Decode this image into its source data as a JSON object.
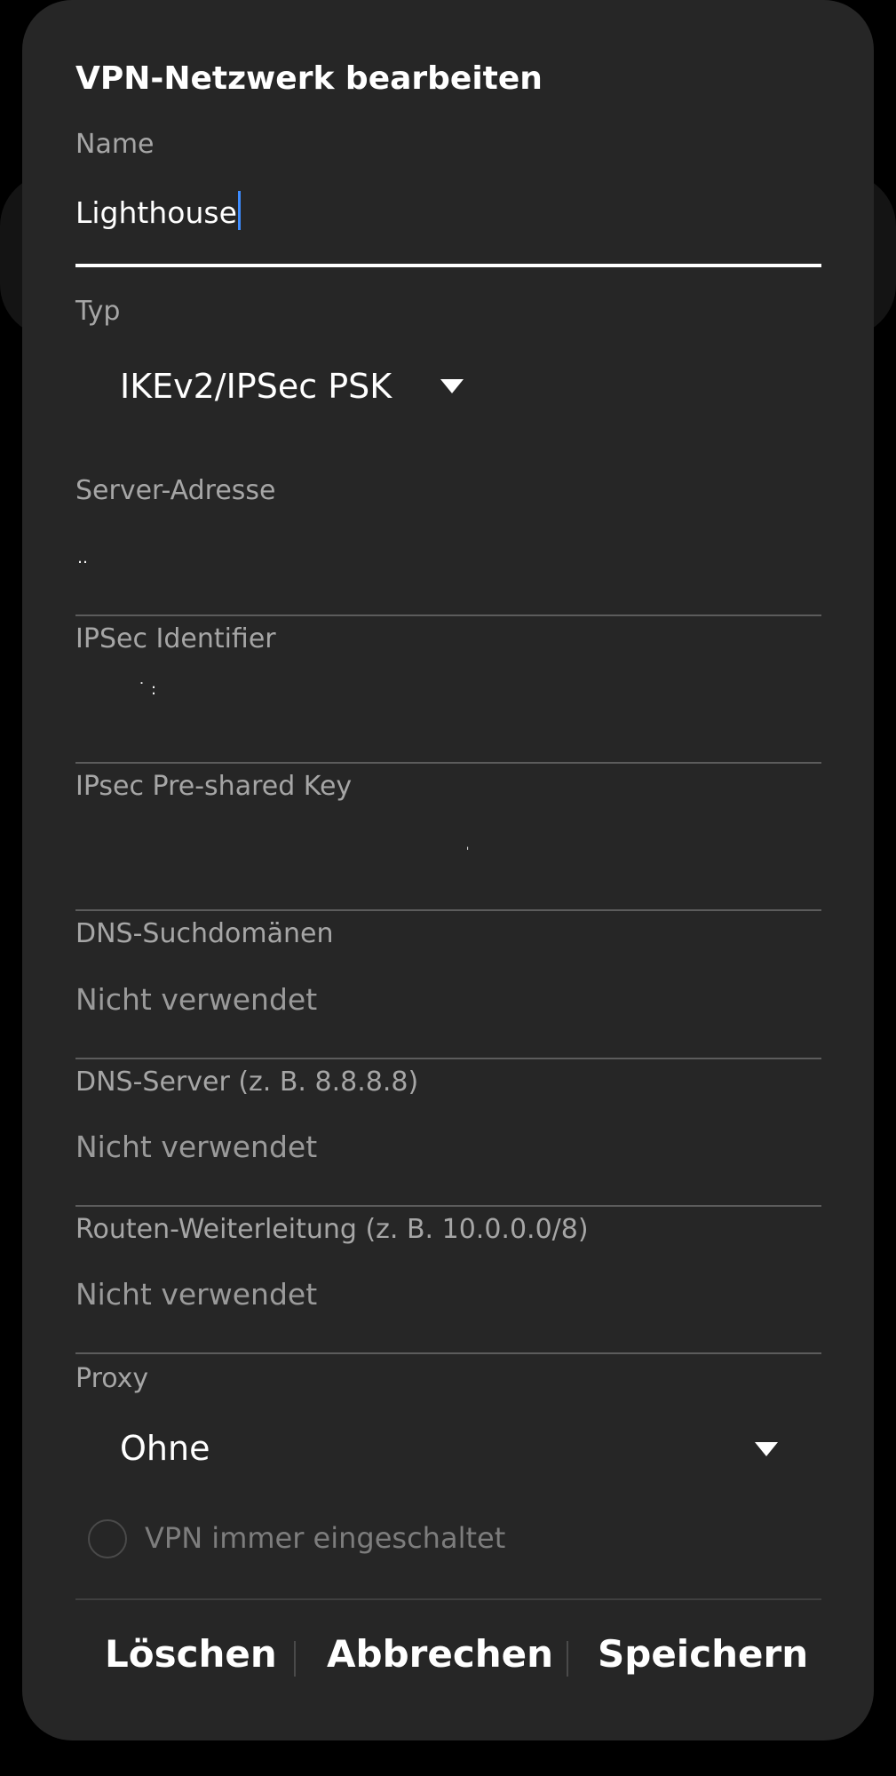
{
  "dialog": {
    "title": "VPN-Netzwerk bearbeiten"
  },
  "fields": {
    "name": {
      "label": "Name",
      "value": "Lighthouse"
    },
    "type": {
      "label": "Typ",
      "value": "IKEv2/IPSec PSK"
    },
    "server": {
      "label": "Server-Adresse"
    },
    "ipsec_identifier": {
      "label": "IPSec Identifier"
    },
    "psk": {
      "label": "IPsec Pre-shared Key"
    },
    "dns_search": {
      "label": "DNS-Suchdomänen",
      "value": "Nicht verwendet"
    },
    "dns_server": {
      "label": "DNS-Server (z. B. 8.8.8.8)",
      "value": "Nicht verwendet"
    },
    "routes": {
      "label": "Routen-Weiterleitung (z. B. 10.0.0.0/8)",
      "value": "Nicht verwendet"
    },
    "proxy": {
      "label": "Proxy",
      "value": "Ohne"
    }
  },
  "always_on": {
    "label": "VPN immer eingeschaltet",
    "checked": false
  },
  "buttons": {
    "delete": "Löschen",
    "cancel": "Abbrechen",
    "save": "Speichern"
  },
  "colors": {
    "dialog_bg": "#262626",
    "cursor": "#3d8cff",
    "text": "#ffffff",
    "label": "#a6a6a6"
  },
  "icons": {
    "dropdown": "caret-down-icon",
    "radio": "radio-unchecked-icon"
  }
}
